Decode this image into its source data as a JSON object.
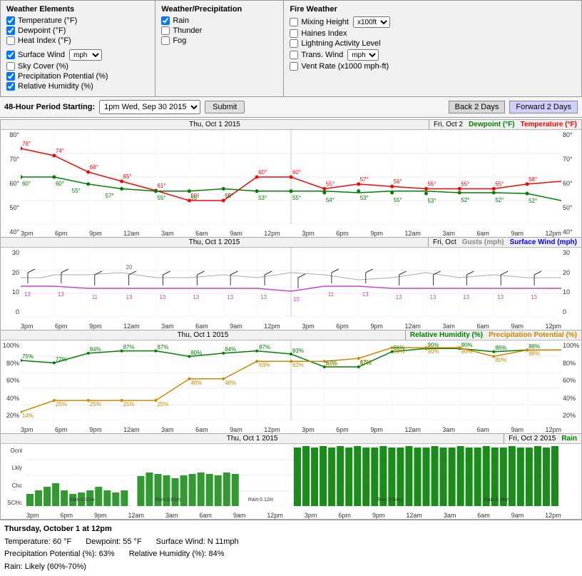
{
  "panels": {
    "weather_elements": {
      "title": "Weather Elements",
      "items": [
        {
          "label": "Temperature (°F)",
          "checked": true
        },
        {
          "label": "Dewpoint (°F)",
          "checked": true
        },
        {
          "label": "Heat Index (°F)",
          "checked": false
        },
        {
          "label": "Surface Wind",
          "checked": true,
          "has_select": true,
          "select_value": "mph"
        },
        {
          "label": "Sky Cover (%)",
          "checked": false
        },
        {
          "label": "Precipitation Potential (%)",
          "checked": true
        },
        {
          "label": "Relative Humidity (%)",
          "checked": true
        }
      ]
    },
    "weather_precipitation": {
      "title": "Weather/Precipitation",
      "items": [
        {
          "label": "Rain",
          "checked": true
        },
        {
          "label": "Thunder",
          "checked": false
        },
        {
          "label": "Fog",
          "checked": false
        }
      ]
    },
    "fire_weather": {
      "title": "Fire Weather",
      "items": [
        {
          "label": "Mixing Height",
          "checked": false,
          "has_select": true,
          "select_value": "x100ft"
        },
        {
          "label": "Haines Index",
          "checked": false
        },
        {
          "label": "Lightning Activity Level",
          "checked": false
        },
        {
          "label": "Trans. Wind",
          "checked": false,
          "has_select": true,
          "select_value": "mph"
        },
        {
          "label": "Vent Rate (x1000 mph-ft)",
          "checked": false
        }
      ]
    }
  },
  "controls": {
    "period_label": "48-Hour Period Starting:",
    "period_value": "1pm Wed, Sep 30 2015",
    "submit_label": "Submit",
    "back_label": "Back 2 Days",
    "forward_label": "Forward 2 Days"
  },
  "chart1": {
    "title_left": "Thu, Oct 1 2015",
    "title_right": "Fri, Oct 2",
    "legend_dewpoint": "Dewpoint (°F)",
    "legend_temp": "Temperature (°F)",
    "y_left": [
      "80°",
      "70°",
      "60°",
      "50°",
      "40°"
    ],
    "y_right": [
      "80°",
      "70°",
      "60°",
      "50°",
      "40°"
    ],
    "x_labels": [
      "3pm",
      "6pm",
      "9pm",
      "12am",
      "3am",
      "6am",
      "9am",
      "12pm",
      "3pm",
      "6pm",
      "9pm",
      "12am",
      "3am",
      "6am",
      "9am",
      "12pm"
    ]
  },
  "chart2": {
    "title_left": "Thu, Oct 1 2015",
    "title_right": "Fri, Oct",
    "legend_gusts": "Gusts (mph)",
    "legend_wind": "Surface Wind (mph)",
    "y_left": [
      "30",
      "20",
      "10",
      "0"
    ],
    "y_right": [
      "30",
      "20",
      "10",
      "0"
    ],
    "x_labels": [
      "3pm",
      "6pm",
      "9pm",
      "12am",
      "3am",
      "6am",
      "9am",
      "12pm",
      "3pm",
      "6pm",
      "9pm",
      "12am",
      "3am",
      "6am",
      "9am",
      "12pm"
    ]
  },
  "chart3": {
    "title_left": "Thu, Oct 1 2015",
    "legend_rh": "Relative Humidity (%)",
    "legend_pp": "Precipitation Potential (%)",
    "y_left": [
      "100%",
      "80%",
      "60%",
      "40%",
      "20%"
    ],
    "y_right": [
      "100%",
      "80%",
      "60%",
      "40%",
      "20%"
    ],
    "x_labels": [
      "3pm",
      "6pm",
      "9pm",
      "12am",
      "3am",
      "6am",
      "9am",
      "12pm",
      "3pm",
      "6pm",
      "9pm",
      "12am",
      "3am",
      "6am",
      "9am",
      "12pm"
    ]
  },
  "chart4": {
    "title_left": "Thu, Oct 1 2015",
    "title_right": "Fri, Oct 2 2015",
    "legend_rain": "Rain",
    "y_left": [
      "Ocnl",
      "Lkly",
      "Chc",
      "SCHc"
    ],
    "x_labels": [
      "3pm",
      "6pm",
      "9pm",
      "12am",
      "3am",
      "6am",
      "9am",
      "12pm",
      "3pm",
      "6pm",
      "9pm",
      "12am",
      "3am",
      "6am",
      "9am",
      "12pm"
    ],
    "rain_labels": [
      "Rain:0.02in",
      "Rain:0.00in",
      "Rain:0.12in",
      "Rain:0.64in",
      "Rain:0.46in"
    ]
  },
  "info": {
    "title": "Thursday, October 1 at 12pm",
    "row1_left": "Temperature: 60 °F   Dewpoint: 55 °F   Surface Wind: N 11mph",
    "row1_right": "",
    "row2_left": "Precipitation Potential (%): 63%   Relative Humidity (%): 84%",
    "row3": "Rain: Likely (60%-70%)"
  }
}
